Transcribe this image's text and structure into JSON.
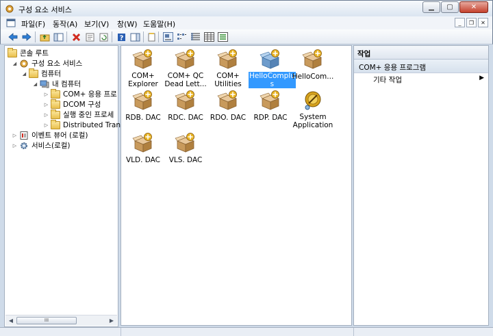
{
  "window": {
    "title": "구성 요소 서비스"
  },
  "menu": [
    "파일(F)",
    "동작(A)",
    "보기(V)",
    "창(W)",
    "도움말(H)"
  ],
  "toolbar": {
    "buttons": [
      "back-arrow-icon",
      "forward-arrow-icon",
      "up-folder-icon",
      "show-tree-icon",
      "delete-icon",
      "properties-icon",
      "refresh-icon",
      "help-icon",
      "show-action-pane-icon",
      "export-list-icon",
      "large-icons-icon",
      "small-icons-icon",
      "list-icon",
      "details-icon",
      "status-view-icon"
    ]
  },
  "tree": {
    "items": [
      {
        "label": "콘솔 루트",
        "icon": "folder-open-icon",
        "level": 0,
        "expander": ""
      },
      {
        "label": "구성 요소 서비스",
        "icon": "component-services-icon",
        "level": 1,
        "expander": "◢"
      },
      {
        "label": "컴퓨터",
        "icon": "folder-icon",
        "level": 2,
        "expander": "◢"
      },
      {
        "label": "내 컴퓨터",
        "icon": "my-computer-icon",
        "level": 3,
        "expander": "◢"
      },
      {
        "label": "COM+ 응용 프로",
        "icon": "folder-icon",
        "level": 4,
        "expander": "▷"
      },
      {
        "label": "DCOM 구성",
        "icon": "folder-icon",
        "level": 4,
        "expander": "▷"
      },
      {
        "label": "실행 중인 프로세",
        "icon": "folder-icon",
        "level": 4,
        "expander": "▷"
      },
      {
        "label": "Distributed Trans",
        "icon": "folder-icon",
        "level": 4,
        "expander": "▷"
      },
      {
        "label": "이벤트 뷰어 (로컬)",
        "icon": "event-viewer-icon",
        "level": 0,
        "expander": "▷"
      },
      {
        "label": "서비스(로컬)",
        "icon": "services-gear-icon",
        "level": 0,
        "expander": "▷"
      }
    ],
    "scroll_thumb": "III"
  },
  "applications": [
    {
      "label": "COM+\nExplorer",
      "icon": "com-package-icon",
      "selected": false
    },
    {
      "label": "COM+ QC\nDead Lett...",
      "icon": "com-package-icon",
      "selected": false
    },
    {
      "label": "COM+\nUtilities",
      "icon": "com-package-icon",
      "selected": false
    },
    {
      "label": "HelloComplu\ns",
      "icon": "com-package-blue-icon",
      "selected": true
    },
    {
      "label": "HelloCom...",
      "icon": "com-package-icon",
      "selected": false
    },
    {
      "label": "RDB. DAC",
      "icon": "com-package-icon",
      "selected": false
    },
    {
      "label": "RDC. DAC",
      "icon": "com-package-icon",
      "selected": false
    },
    {
      "label": "RDO. DAC",
      "icon": "com-package-icon",
      "selected": false
    },
    {
      "label": "RDP. DAC",
      "icon": "com-package-icon",
      "selected": false
    },
    {
      "label": "System\nApplication",
      "icon": "system-application-icon",
      "selected": false
    },
    {
      "label": "VLD. DAC",
      "icon": "com-package-icon",
      "selected": false
    },
    {
      "label": "VLS. DAC",
      "icon": "com-package-icon",
      "selected": false
    }
  ],
  "actions": {
    "header": "작업",
    "section": "COM+ 응용 프로그램",
    "item": "기타 작업",
    "item_arrow": "▶"
  },
  "colors": {
    "selection": "#3399ff",
    "close_button": "#c5412d"
  }
}
